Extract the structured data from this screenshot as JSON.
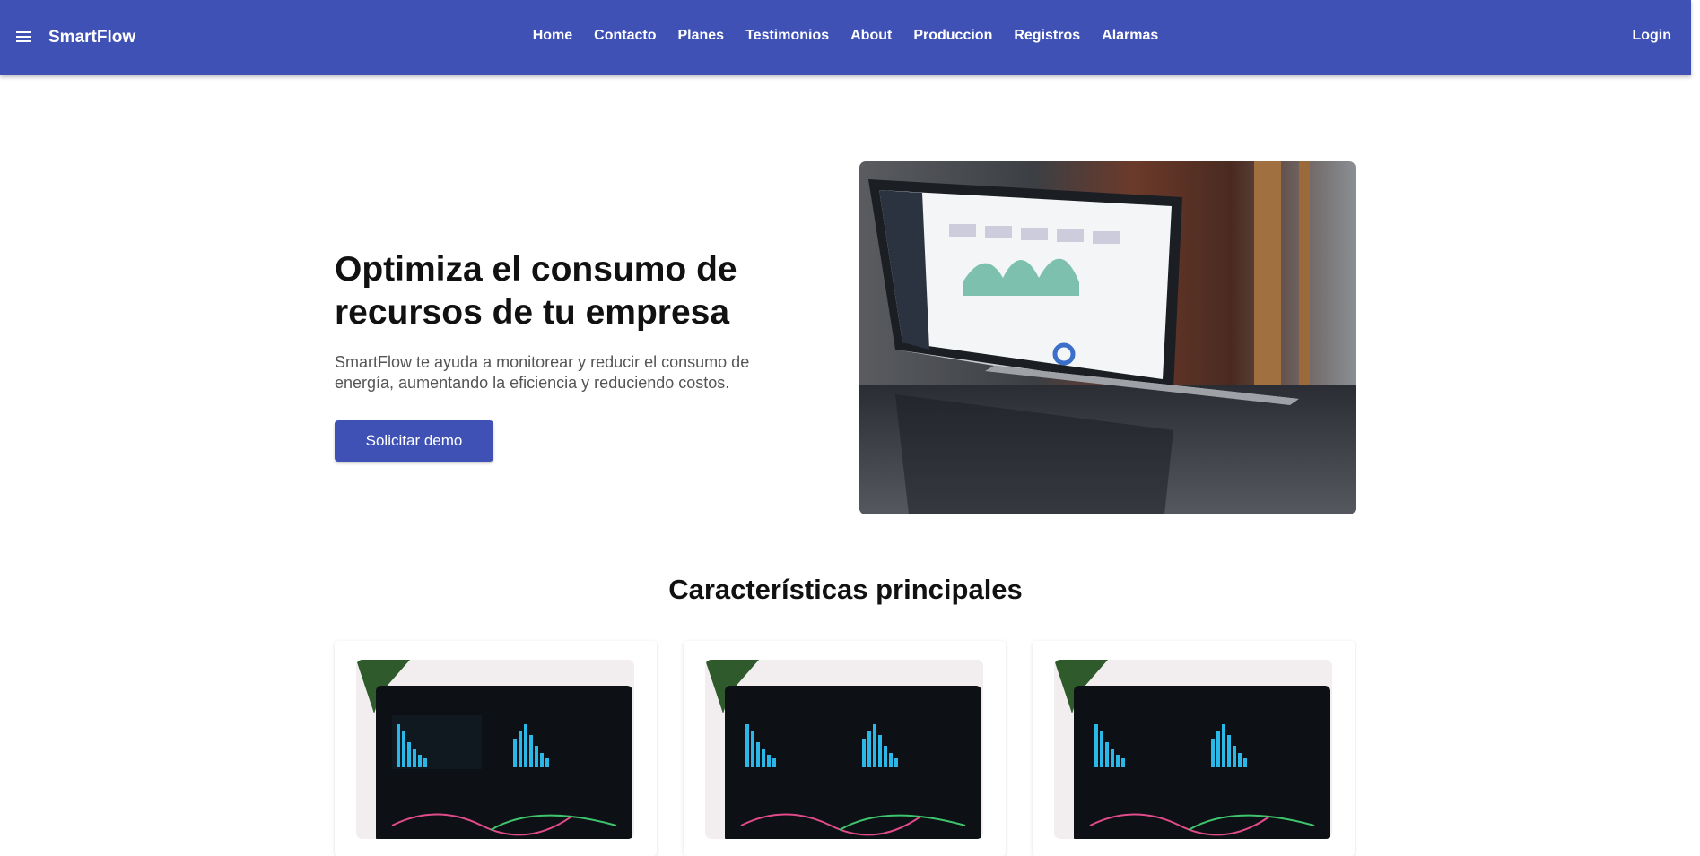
{
  "appbar": {
    "brand": "SmartFlow",
    "nav": [
      "Home",
      "Contacto",
      "Planes",
      "Testimonios",
      "About",
      "Produccion",
      "Registros",
      "Alarmas"
    ],
    "login": "Login",
    "color": "#3f51b5"
  },
  "hero": {
    "title": "Optimiza el consumo de recursos de tu empresa",
    "subtitle": "SmartFlow te ayuda a monitorear y reducir el consumo de energía, aumentando la eficiencia y reduciendo costos.",
    "cta": "Solicitar demo"
  },
  "features": {
    "title": "Características principales"
  }
}
